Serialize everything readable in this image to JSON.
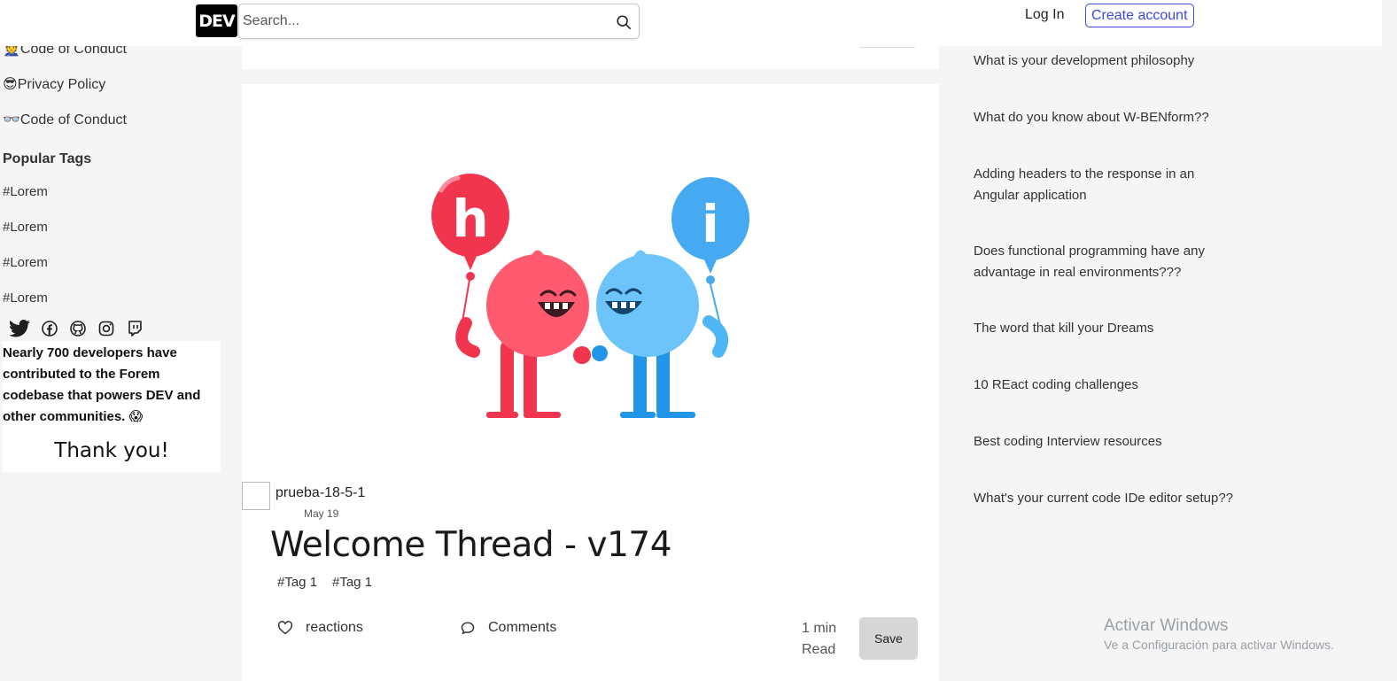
{
  "header": {
    "logo": "DEV",
    "search_placeholder": "Search...",
    "login": "Log In",
    "create_account": "Create account"
  },
  "left_sidebar": {
    "links": [
      {
        "emoji": "👮",
        "label": "Code of Conduct"
      },
      {
        "emoji": "😎",
        "label": "Privacy Policy"
      },
      {
        "emoji": "👓",
        "label": "Code of Conduct"
      }
    ],
    "popular_tags_title": "Popular Tags",
    "tags": [
      "#Lorem",
      "#Lorem",
      "#Lorem",
      "#Lorem"
    ],
    "social_icons": [
      "twitter-icon",
      "facebook-icon",
      "github-icon",
      "instagram-icon",
      "twitch-icon"
    ],
    "thanks_text": "Nearly 700 developers have contributed to the Forem codebase that powers DEV and other communities. 😱",
    "thanks_sub": "Thank you!"
  },
  "post": {
    "author": "prueba-18-5-1",
    "date": "May 19",
    "title": "Welcome Thread - v174",
    "tags": [
      "#Tag 1",
      "#Tag 1"
    ],
    "reactions_label": "reactions",
    "comments_label": "Comments",
    "read_time": "1 min Read",
    "save_label": "Save",
    "image_letters": [
      "h",
      "i"
    ]
  },
  "right_sidebar": {
    "items": [
      "What is your development philosophy",
      "What do you know about W-BENform??",
      "Adding headers to the response in an Angular application",
      "Does functional programming have any advantage in real environments???",
      "The word that kill your Dreams",
      "10 REact coding challenges",
      "Best coding Interview resources",
      "What's your current code IDe editor setup??"
    ]
  },
  "watermark": {
    "line1": "Activar Windows",
    "line2": "Ve a Configuración para activar Windows."
  },
  "colors": {
    "accent": "#3b49df",
    "balloon_red": "#f2354f",
    "balloon_blue": "#45aaf2"
  }
}
